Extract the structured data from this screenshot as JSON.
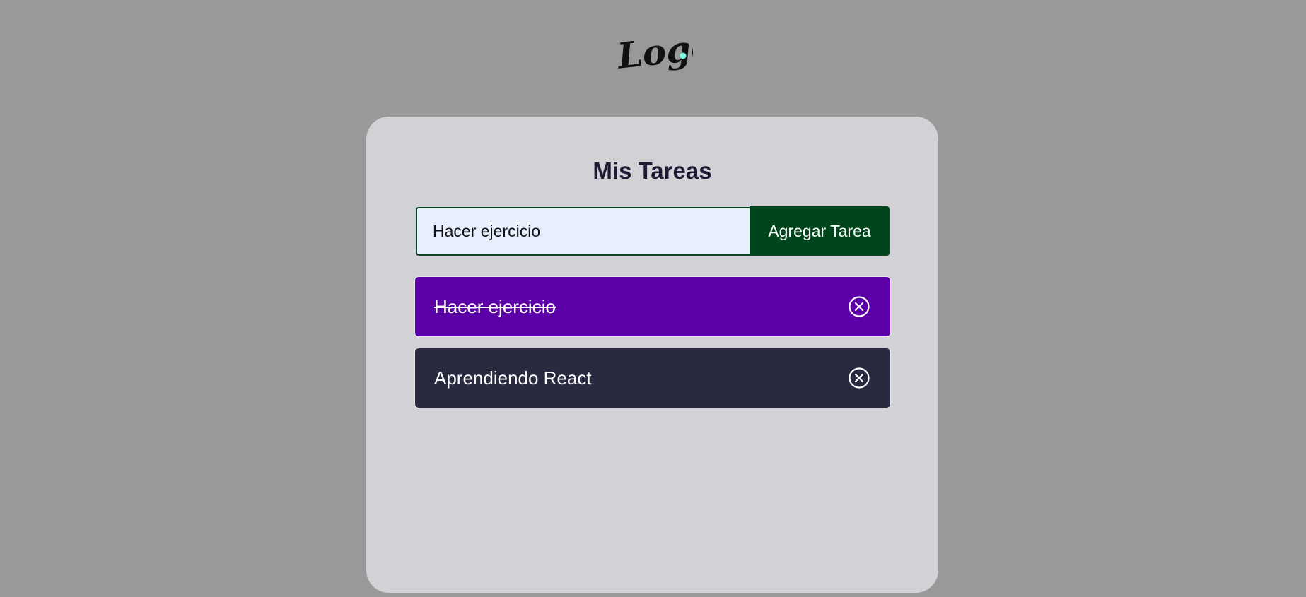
{
  "logo": {
    "text": "Logo",
    "dot_color": "#7fffe6"
  },
  "app": {
    "title": "Mis Tareas"
  },
  "form": {
    "input_value": "Hacer ejercicio",
    "button_label": "Agregar Tarea"
  },
  "tasks": [
    {
      "text": "Hacer ejercicio",
      "completed": true,
      "color": "#5c00a8"
    },
    {
      "text": "Aprendiendo React",
      "completed": false,
      "color": "#292940"
    }
  ],
  "icons": {
    "delete": "close-circle-icon"
  }
}
